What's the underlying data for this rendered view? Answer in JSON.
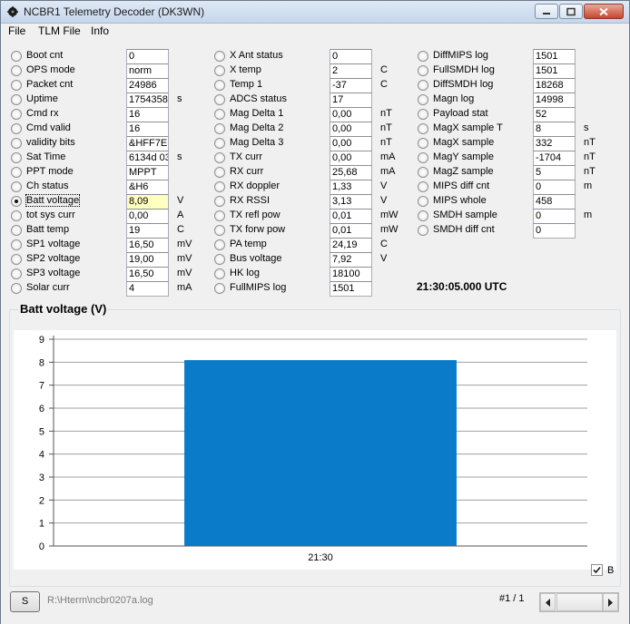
{
  "window": {
    "title": "NCBR1 Telemetry Decoder (DK3WN)"
  },
  "menu": {
    "items": [
      "File",
      "TLM File",
      "Info"
    ]
  },
  "columns": [
    {
      "rows": [
        {
          "label": "Boot cnt",
          "value": "0",
          "unit": "",
          "checked": false
        },
        {
          "label": "OPS mode",
          "value": "norm",
          "unit": "",
          "checked": false
        },
        {
          "label": "Packet cnt",
          "value": "24986",
          "unit": "",
          "checked": false
        },
        {
          "label": "Uptime",
          "value": "1754358",
          "unit": "s",
          "checked": false
        },
        {
          "label": "Cmd rx",
          "value": "16",
          "unit": "",
          "checked": false
        },
        {
          "label": "Cmd valid",
          "value": "16",
          "unit": "",
          "checked": false
        },
        {
          "label": "validity bits",
          "value": "&HFF7E",
          "unit": "",
          "checked": false
        },
        {
          "label": "Sat Time",
          "value": "6134d 03",
          "unit": "s",
          "checked": false
        },
        {
          "label": "PPT mode",
          "value": "MPPT",
          "unit": "",
          "checked": false
        },
        {
          "label": "Ch status",
          "value": "&H6",
          "unit": "",
          "checked": false
        },
        {
          "label": "Batt voltage",
          "value": "8,09",
          "unit": "V",
          "checked": true
        },
        {
          "label": "tot sys curr",
          "value": "0,00",
          "unit": "A",
          "checked": false
        },
        {
          "label": "Batt temp",
          "value": "19",
          "unit": "C",
          "checked": false
        },
        {
          "label": "SP1 voltage",
          "value": "16,50",
          "unit": "mV",
          "checked": false
        },
        {
          "label": "SP2 voltage",
          "value": "19,00",
          "unit": "mV",
          "checked": false
        },
        {
          "label": "SP3 voltage",
          "value": "16,50",
          "unit": "mV",
          "checked": false
        },
        {
          "label": "Solar curr",
          "value": "4",
          "unit": "mA",
          "checked": false
        }
      ]
    },
    {
      "rows": [
        {
          "label": "X Ant status",
          "value": "0",
          "unit": "",
          "checked": false
        },
        {
          "label": "X temp",
          "value": "2",
          "unit": "C",
          "checked": false
        },
        {
          "label": "Temp 1",
          "value": "-37",
          "unit": "C",
          "checked": false
        },
        {
          "label": "ADCS status",
          "value": "17",
          "unit": "",
          "checked": false
        },
        {
          "label": "Mag Delta 1",
          "value": "0,00",
          "unit": "nT",
          "checked": false
        },
        {
          "label": "Mag Delta 2",
          "value": "0,00",
          "unit": "nT",
          "checked": false
        },
        {
          "label": "Mag Delta 3",
          "value": "0,00",
          "unit": "nT",
          "checked": false
        },
        {
          "label": "TX curr",
          "value": "0,00",
          "unit": "mA",
          "checked": false
        },
        {
          "label": "RX curr",
          "value": "25,68",
          "unit": "mA",
          "checked": false
        },
        {
          "label": "RX doppler",
          "value": "1,33",
          "unit": "V",
          "checked": false
        },
        {
          "label": "RX RSSI",
          "value": "3,13",
          "unit": "V",
          "checked": false
        },
        {
          "label": "TX refl pow",
          "value": "0,01",
          "unit": "mW",
          "checked": false
        },
        {
          "label": "TX forw pow",
          "value": "0,01",
          "unit": "mW",
          "checked": false
        },
        {
          "label": "PA temp",
          "value": "24,19",
          "unit": "C",
          "checked": false
        },
        {
          "label": "Bus voltage",
          "value": "7,92",
          "unit": "V",
          "checked": false
        },
        {
          "label": "HK log",
          "value": "18100",
          "unit": "",
          "checked": false
        },
        {
          "label": "FullMIPS log",
          "value": "1501",
          "unit": "",
          "checked": false
        }
      ]
    },
    {
      "rows": [
        {
          "label": "DiffMIPS log",
          "value": "1501",
          "unit": "",
          "checked": false
        },
        {
          "label": "FullSMDH log",
          "value": "1501",
          "unit": "",
          "checked": false
        },
        {
          "label": "DiffSMDH log",
          "value": "18268",
          "unit": "",
          "checked": false
        },
        {
          "label": "Magn log",
          "value": "14998",
          "unit": "",
          "checked": false
        },
        {
          "label": "Payload stat",
          "value": "52",
          "unit": "",
          "checked": false
        },
        {
          "label": "MagX sample T",
          "value": "8",
          "unit": "s",
          "checked": false
        },
        {
          "label": "MagX sample",
          "value": "332",
          "unit": "nT",
          "checked": false
        },
        {
          "label": "MagY sample",
          "value": "-1704",
          "unit": "nT",
          "checked": false
        },
        {
          "label": "MagZ sample",
          "value": "5",
          "unit": "nT",
          "checked": false
        },
        {
          "label": "MIPS diff cnt",
          "value": "0",
          "unit": "m",
          "checked": false
        },
        {
          "label": "MIPS whole",
          "value": "458",
          "unit": "",
          "checked": false
        },
        {
          "label": "SMDH sample",
          "value": "0",
          "unit": "m",
          "checked": false
        },
        {
          "label": "SMDH diff cnt",
          "value": "0",
          "unit": "",
          "checked": false
        }
      ]
    }
  ],
  "time_display": "21:30:05.000 UTC",
  "chart_group_title": "Batt voltage (V)",
  "chart_data": {
    "type": "bar",
    "categories": [
      "21:30"
    ],
    "values": [
      8.09
    ],
    "title": "Batt voltage (V)",
    "xlabel": "",
    "ylabel": "",
    "ylim": [
      0,
      9
    ],
    "yticks": [
      0,
      1,
      2,
      3,
      4,
      5,
      6,
      7,
      8,
      9
    ],
    "grid": true,
    "bar_color": "#0a7bc9"
  },
  "checkbox": {
    "label": "B",
    "checked": true
  },
  "footer": {
    "button_label": "S",
    "file_path": "R:\\Hterm\\ncbr0207a.log",
    "page_indicator": "#1 / 1"
  }
}
